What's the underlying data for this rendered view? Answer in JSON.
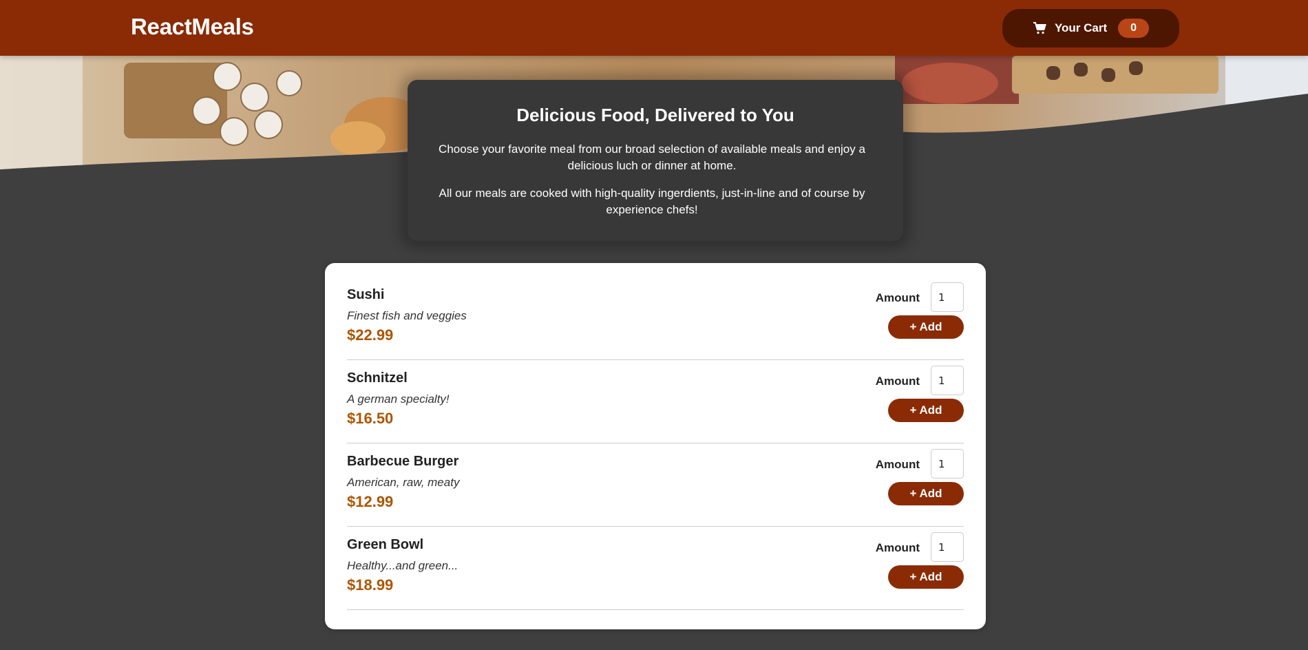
{
  "header": {
    "logo": "ReactMeals",
    "cart": {
      "label": "Your Cart",
      "count": "0",
      "icon": "cart-icon"
    }
  },
  "colors": {
    "header_bg": "#8a2b06",
    "cart_bg": "#4d1601",
    "badge_bg": "#b94517",
    "page_bg": "#3f3f3f",
    "summary_bg": "#383838",
    "price": "#ad5502",
    "add_button": "#8a2b06"
  },
  "summary": {
    "title": "Delicious Food, Delivered to You",
    "paragraph1": "Choose your favorite meal from our broad selection of available meals and enjoy a delicious luch or dinner at home.",
    "paragraph2": "All our meals are cooked with high-quality ingerdients, just-in-line and of course by experience chefs!"
  },
  "meals": [
    {
      "name": "Sushi",
      "description": "Finest fish and veggies",
      "price": "$22.99",
      "amount_label": "Amount",
      "amount_value": "1",
      "add_label": "+ Add"
    },
    {
      "name": "Schnitzel",
      "description": "A german specialty!",
      "price": "$16.50",
      "amount_label": "Amount",
      "amount_value": "1",
      "add_label": "+ Add"
    },
    {
      "name": "Barbecue Burger",
      "description": "American, raw, meaty",
      "price": "$12.99",
      "amount_label": "Amount",
      "amount_value": "1",
      "add_label": "+ Add"
    },
    {
      "name": "Green Bowl",
      "description": "Healthy...and green...",
      "price": "$18.99",
      "amount_label": "Amount",
      "amount_value": "1",
      "add_label": "+ Add"
    }
  ]
}
